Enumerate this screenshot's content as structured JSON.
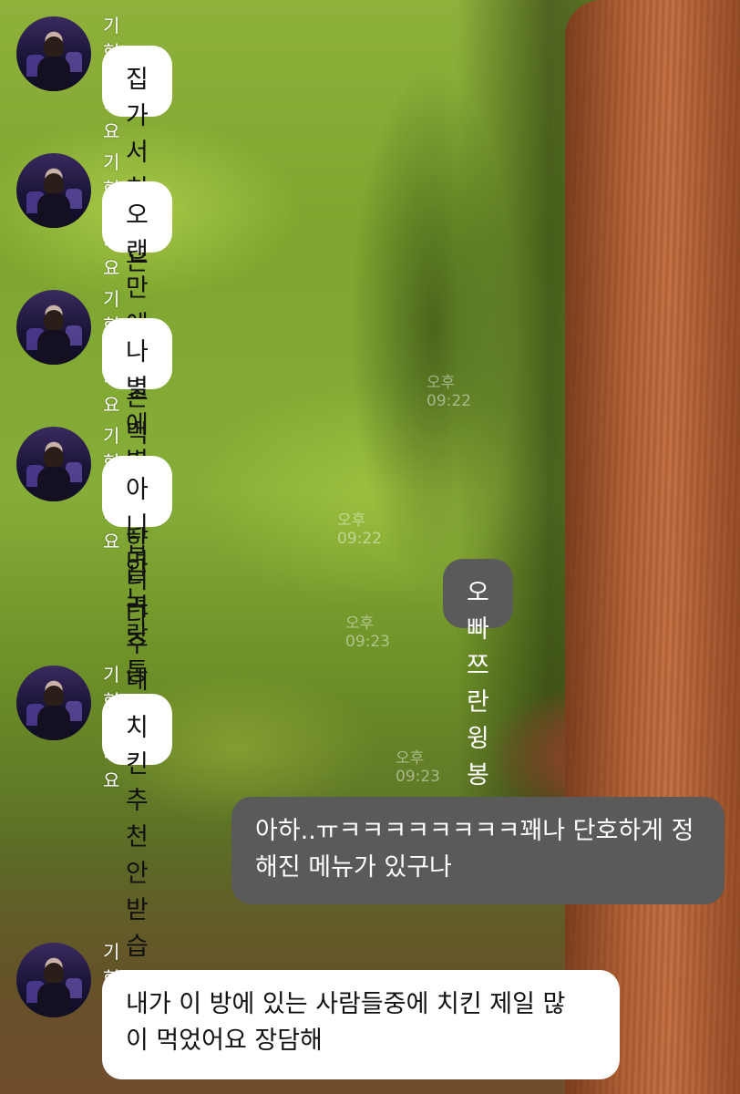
{
  "chat": {
    "messages": [
      {
        "sender": "기현인디요",
        "text": "집가서 치킨은"
      },
      {
        "sender": "기현인디요",
        "text": "오랜만에 교촌 먹을까합니다"
      },
      {
        "sender": "기현인디요",
        "text": "나 별에별걸 다 알려주네",
        "time": "오후 09:22"
      },
      {
        "sender": "기현인디요",
        "text": "아니면 노랑통닭",
        "time": "오후 09:22"
      },
      {
        "text": "오빠 쯔란윙봉은 어때",
        "time": "오후 09:23"
      },
      {
        "sender": "기현인디요",
        "text": "치킨 추천 안받습니다",
        "time": "오후 09:23"
      },
      {
        "text": "아하..ㅠㅋㅋㅋㅋㅋㅋㅋㅋ꽤나 단호하게 정\n해진 메뉴가 있구나"
      },
      {
        "sender": "기현인디요",
        "text": "내가 이 방에 있는 사람들중에 치킨 제일 많\n이 먹었어요 장담해"
      }
    ]
  },
  "colors": {
    "incoming_bubble": "#ffffff",
    "outgoing_bubble": "#5a5a5a",
    "sender_name": "#ffffff"
  }
}
